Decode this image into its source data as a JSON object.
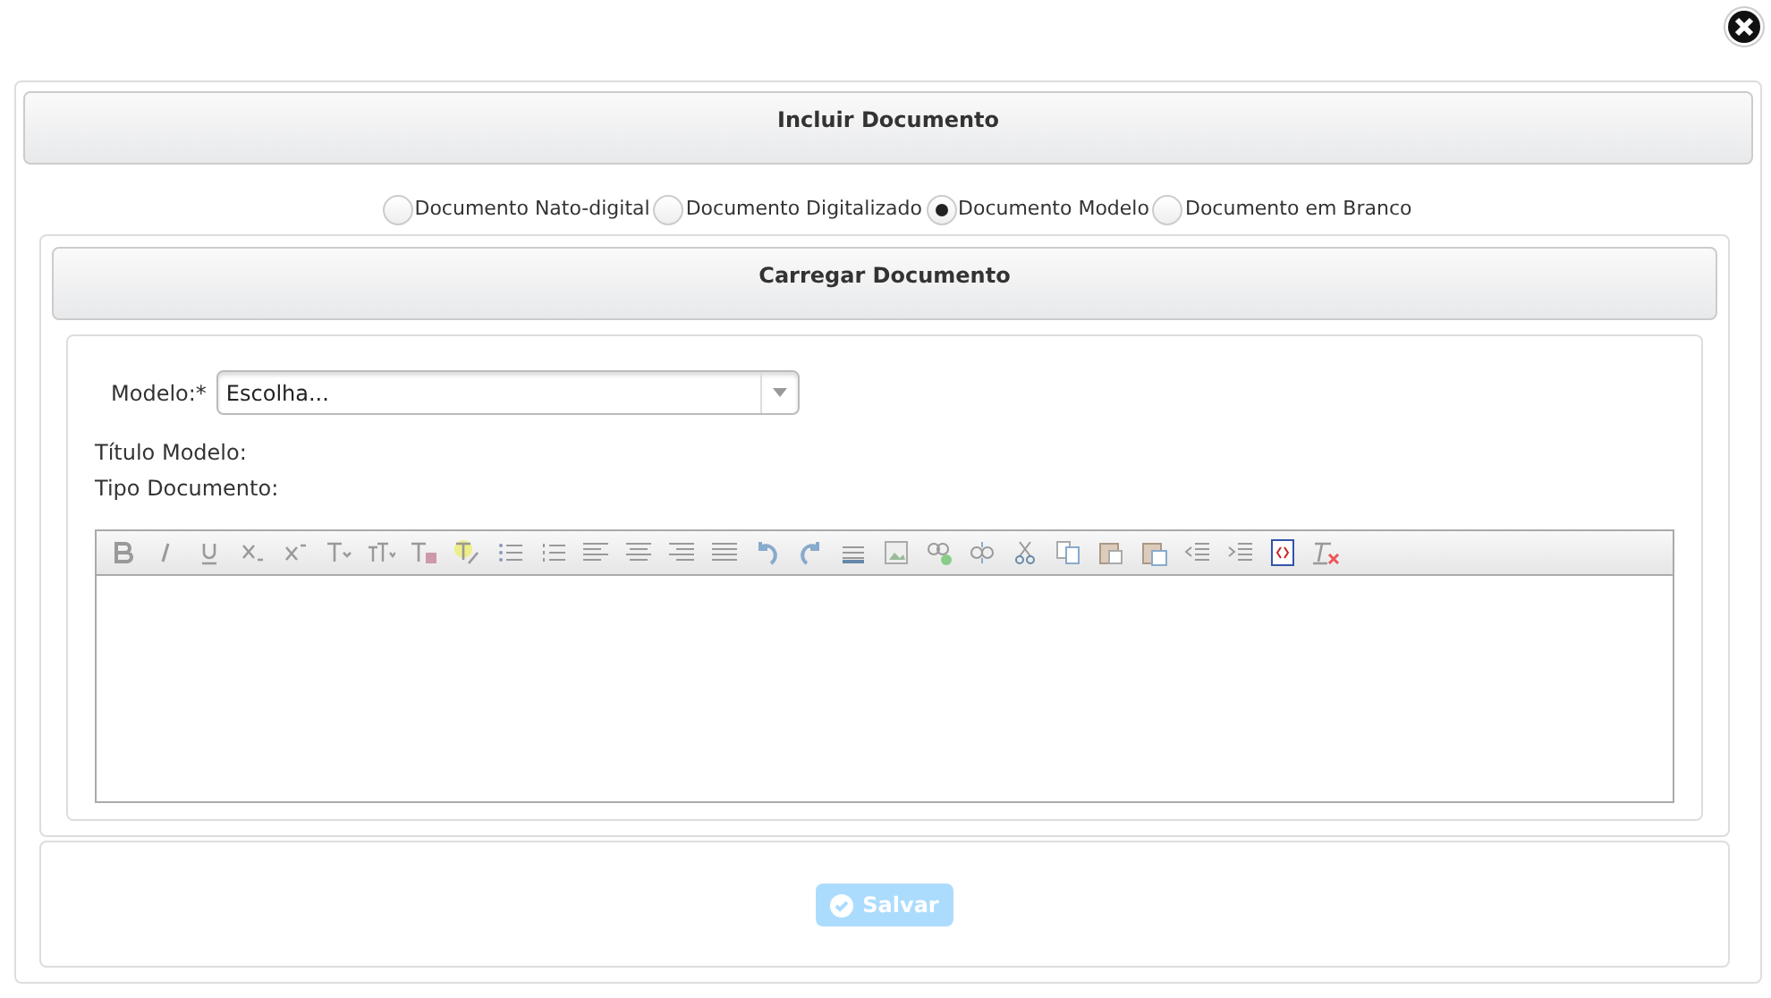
{
  "dialog": {
    "title": "Incluir Documento"
  },
  "document_types": [
    {
      "label": "Documento Nato-digital",
      "selected": false
    },
    {
      "label": "Documento Digitalizado",
      "selected": false
    },
    {
      "label": "Documento Modelo",
      "selected": true
    },
    {
      "label": "Documento em Branco",
      "selected": false
    }
  ],
  "section": {
    "title": "Carregar Documento"
  },
  "modelo": {
    "label": "Modelo:*",
    "value": "Escolha..."
  },
  "info_labels": [
    "Título Modelo:",
    "Tipo Documento:"
  ],
  "save_button": {
    "label": "Salvar",
    "disabled": true
  }
}
